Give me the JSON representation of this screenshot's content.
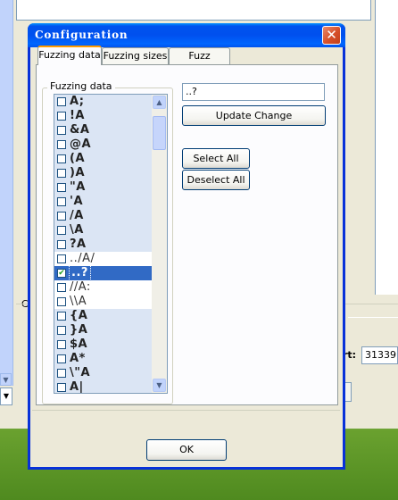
{
  "background": {
    "c_letter": "C",
    "port_label": "rt:",
    "port_value": "31339"
  },
  "dialog": {
    "title": "Configuration",
    "close_glyph": "✕",
    "tabs": [
      {
        "label": "Fuzzing data",
        "active": true
      },
      {
        "label": "Fuzzing sizes",
        "active": false
      },
      {
        "label": "Fuzz options",
        "active": false
      }
    ],
    "group_title": "Fuzzing data",
    "items": [
      {
        "label": "A;",
        "checked": false
      },
      {
        "label": "!A",
        "checked": false
      },
      {
        "label": "&A",
        "checked": false
      },
      {
        "label": "@A",
        "checked": false
      },
      {
        "label": "(A",
        "checked": false
      },
      {
        "label": ")A",
        "checked": false
      },
      {
        "label": "\"A",
        "checked": false
      },
      {
        "label": "'A",
        "checked": false
      },
      {
        "label": "/A",
        "checked": false
      },
      {
        "label": "\\A",
        "checked": false
      },
      {
        "label": "?A",
        "checked": false
      },
      {
        "label": "../A/",
        "checked": false
      },
      {
        "label": "..?",
        "checked": true,
        "selected": true
      },
      {
        "label": "//A:",
        "checked": false
      },
      {
        "label": "\\\\A",
        "checked": false
      },
      {
        "label": "{A",
        "checked": false
      },
      {
        "label": "}A",
        "checked": false
      },
      {
        "label": "$A",
        "checked": false
      },
      {
        "label": "A*",
        "checked": false
      },
      {
        "label": "\\\"A",
        "checked": false
      },
      {
        "label": "A|",
        "checked": false
      }
    ],
    "input_value": "..?",
    "update_label": "Update Change",
    "select_all_label": "Select All",
    "deselect_all_label": "Deselect All",
    "ok_label": "OK"
  },
  "icons": {
    "scroll_up": "chevron-up-icon",
    "scroll_down": "chevron-down-icon",
    "close": "close-icon",
    "check": "checkmark-icon"
  },
  "colors": {
    "titlebar": "#0053ee",
    "selection": "#316ac5",
    "item_bg": "#dbe5f4",
    "active_tab_accent": "#ff9c00"
  }
}
